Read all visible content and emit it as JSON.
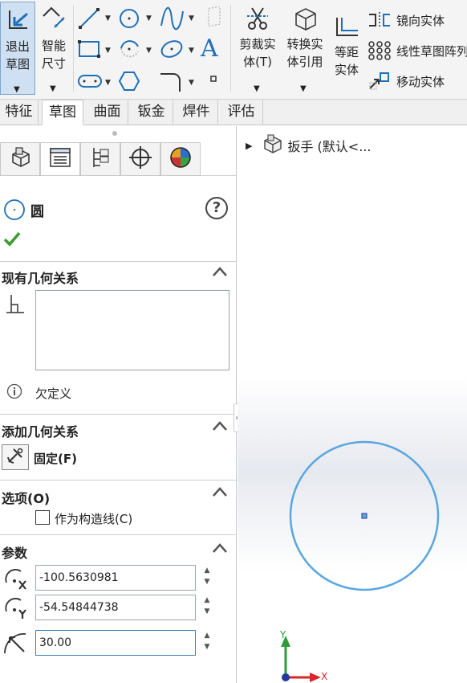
{
  "ribbon": {
    "exit_sketch": [
      "退出",
      "草图"
    ],
    "smart_dimension": [
      "智能",
      "尺寸"
    ],
    "trim_entities": [
      "剪裁实",
      "体(T)"
    ],
    "convert_entities": [
      "转换实",
      "体引用"
    ],
    "offset_entities": [
      "等距",
      "实体"
    ],
    "mirror_entities": "镜向实体",
    "linear_pattern": "线性草图阵列",
    "move_entities": "移动实体",
    "text_tool_glyph": "A"
  },
  "tabs": [
    {
      "label": "特征"
    },
    {
      "label": "草图"
    },
    {
      "label": "曲面"
    },
    {
      "label": "钣金"
    },
    {
      "label": "焊件"
    },
    {
      "label": "评估"
    }
  ],
  "active_tab": "草图",
  "property_manager": {
    "title": "圆",
    "help_glyph": "?",
    "existing_relations": {
      "header": "现有几何关系",
      "status": "欠定义"
    },
    "add_relations": {
      "header": "添加几何关系",
      "fix_label": "固定(F)"
    },
    "options": {
      "header": "选项(O)",
      "construction_label": "作为构造线(C)",
      "construction_checked": false
    },
    "parameters": {
      "header": "参数",
      "center_x": "-100.5630981",
      "center_y": "-54.54844738",
      "radius": "30.00"
    }
  },
  "feature_tree": {
    "root_label": "扳手  (默认<..."
  },
  "triad": {
    "x_label": "X",
    "y_label": "Y"
  },
  "colors": {
    "accent": "#3c7fb1",
    "circle": "#5aa6e0",
    "check": "#3a9a2f",
    "triad_x": "#d9262b",
    "triad_y": "#2f9a3a",
    "triad_z": "#1f3a9a"
  }
}
